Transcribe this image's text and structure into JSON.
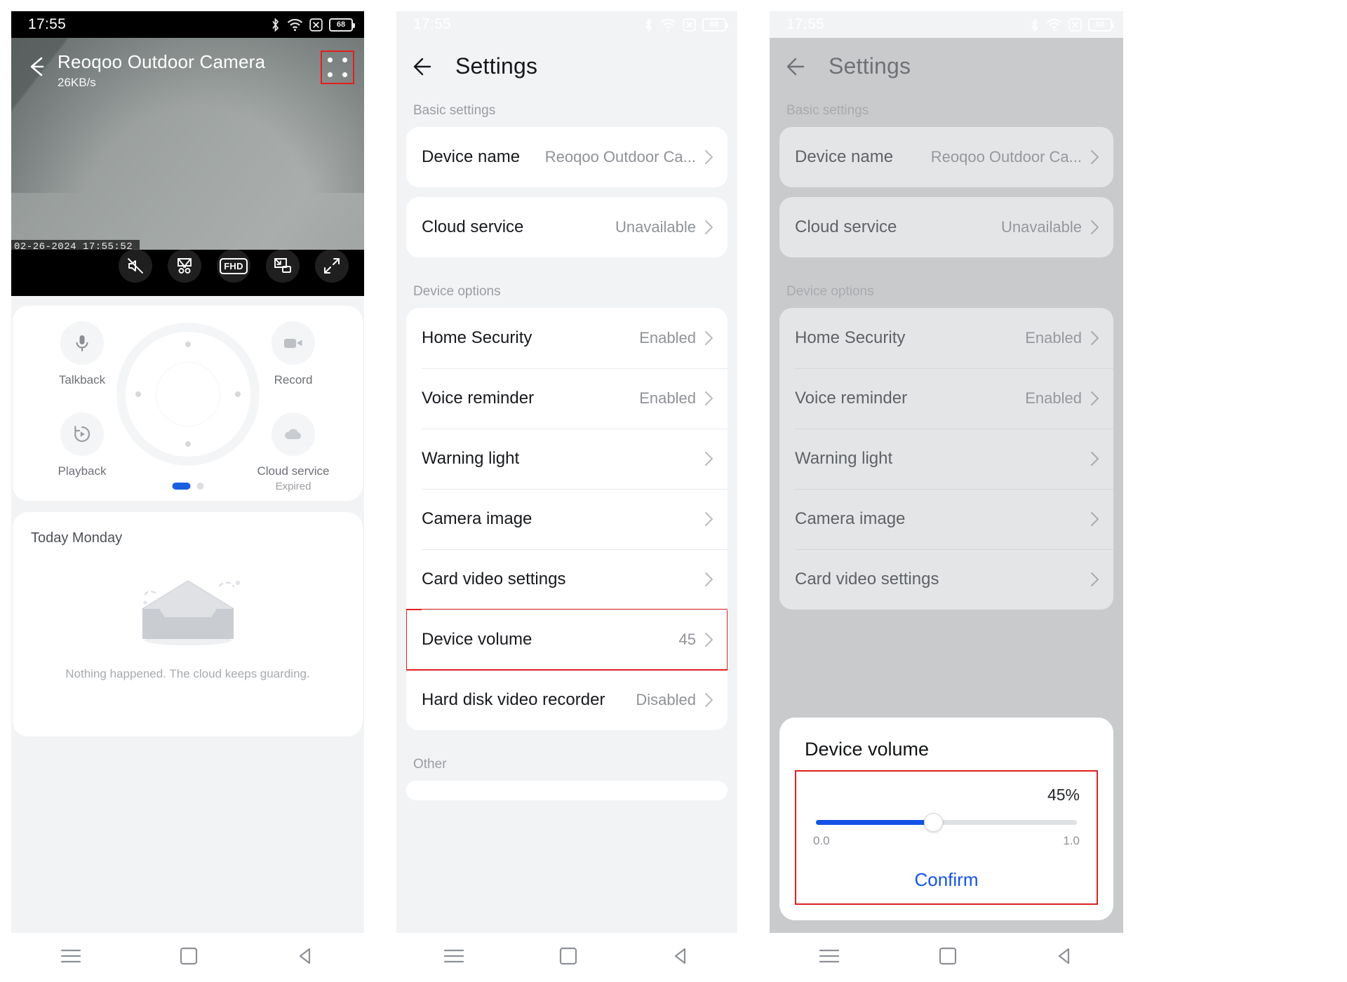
{
  "status_bar": {
    "time": "17:55",
    "icons": [
      "bluetooth-icon",
      "wifi-icon",
      "sim-off-icon"
    ],
    "battery_level": "68"
  },
  "panel_live": {
    "title": "Reoqoo Outdoor Camera",
    "bitrate": "26KB/s",
    "back_icon": "back-arrow-icon",
    "menu_icon": "four-dots-menu-icon",
    "video_timestamp": "02-26-2024  17:55:52",
    "video_controls": [
      {
        "name": "mute-button",
        "icon": "speaker-muted-icon",
        "label": ""
      },
      {
        "name": "snapshot-button",
        "icon": "scissors-icon",
        "label": ""
      },
      {
        "name": "quality-button",
        "icon": "fhd-badge-icon",
        "label": "FHD"
      },
      {
        "name": "pip-button",
        "icon": "picture-in-picture-icon",
        "label": ""
      },
      {
        "name": "fullscreen-button",
        "icon": "expand-arrows-icon",
        "label": ""
      }
    ],
    "controls": [
      {
        "label": "Talkback",
        "sub": "",
        "icon": "microphone-icon"
      },
      {
        "label": "Record",
        "sub": "",
        "icon": "video-camera-icon"
      },
      {
        "label": "Playback",
        "sub": "",
        "icon": "playback-replay-icon"
      },
      {
        "label": "Cloud service",
        "sub": "Expired",
        "icon": "cloud-icon"
      }
    ],
    "pager": {
      "total": 2,
      "active": 1
    },
    "events": {
      "title": "Today Monday",
      "empty_text": "Nothing happened. The cloud keeps guarding.",
      "empty_icon": "empty-inbox-illustration"
    }
  },
  "panel_settings": {
    "title": "Settings",
    "back_icon": "back-arrow-icon",
    "sections": [
      {
        "label": "Basic settings",
        "rows": [
          {
            "label": "Device name",
            "value": "Reoqoo Outdoor Ca...",
            "chevron": "chevron-right-icon"
          }
        ]
      },
      {
        "label": "",
        "rows": [
          {
            "label": "Cloud service",
            "value": "Unavailable",
            "chevron": "chevron-right-icon"
          }
        ]
      },
      {
        "label": "Device options",
        "rows": [
          {
            "label": "Home Security",
            "value": "Enabled",
            "chevron": "chevron-right-icon"
          },
          {
            "label": "Voice reminder",
            "value": "Enabled",
            "chevron": "chevron-right-icon"
          },
          {
            "label": "Warning light",
            "value": "",
            "chevron": "chevron-right-icon"
          },
          {
            "label": "Camera image",
            "value": "",
            "chevron": "chevron-right-icon"
          },
          {
            "label": "Card video settings",
            "value": "",
            "chevron": "chevron-right-icon"
          },
          {
            "label": "Device volume",
            "value": "45",
            "chevron": "chevron-right-icon",
            "highlighted": true
          },
          {
            "label": "Hard disk video recorder",
            "value": "Disabled",
            "chevron": "chevron-right-icon"
          }
        ]
      },
      {
        "label": "Other",
        "rows": []
      }
    ]
  },
  "panel_volume_dialog": {
    "title": "Device volume",
    "percent_label": "45%",
    "value": 45,
    "min_label": "0.0",
    "max_label": "1.0",
    "confirm_label": "Confirm"
  },
  "nav_bar": {
    "items": [
      {
        "name": "nav-recents-button",
        "icon": "menu-lines-icon"
      },
      {
        "name": "nav-home-button",
        "icon": "square-icon"
      },
      {
        "name": "nav-back-button",
        "icon": "back-triangle-icon"
      }
    ]
  },
  "colors": {
    "accent_blue": "#1452e6",
    "highlight_red": "#e02020",
    "page_bg": "#f2f3f5",
    "card_bg": "#ffffff",
    "dim_bg": "#c9cacc"
  }
}
